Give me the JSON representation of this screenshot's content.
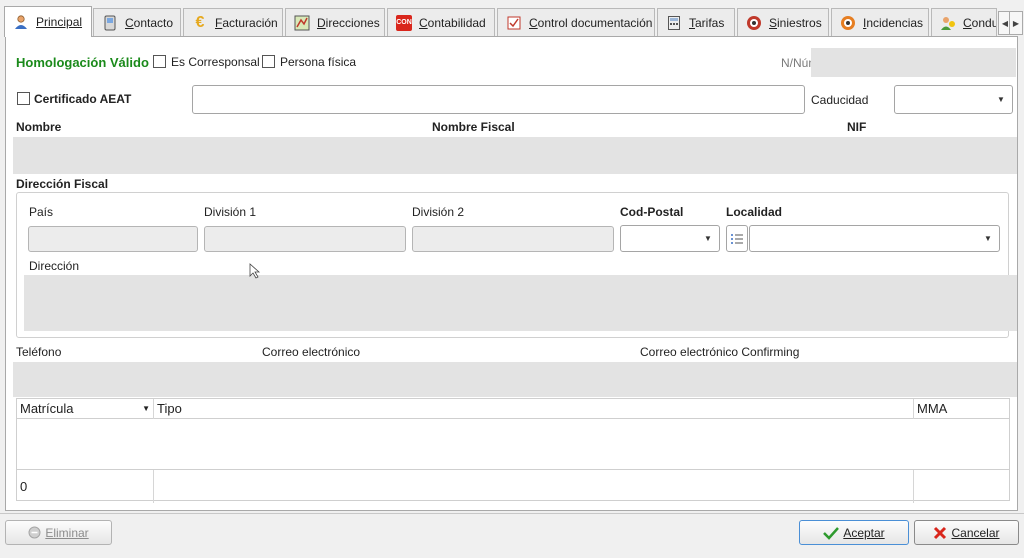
{
  "tabs": [
    {
      "label": "Principal",
      "icon": "person-icon",
      "active": true
    },
    {
      "label": "Contacto",
      "icon": "phone-icon"
    },
    {
      "label": "Facturación",
      "icon": "euro-icon"
    },
    {
      "label": "Direcciones",
      "icon": "map-icon"
    },
    {
      "label": "Contabilidad",
      "icon": "accounting-icon",
      "badge": "CON"
    },
    {
      "label": "Control documentación",
      "icon": "checklist-icon"
    },
    {
      "label": "Tarifas",
      "icon": "calculator-icon"
    },
    {
      "label": "Siniestros",
      "icon": "accident-icon"
    },
    {
      "label": "Incidencias",
      "icon": "incident-icon"
    },
    {
      "label": "Condu",
      "icon": "driver-icon"
    }
  ],
  "header": {
    "homologacion": "Homologación Válido",
    "es_corresponsal": "Es Corresponsal",
    "persona_fisica": "Persona física",
    "num_label": "N/Núm",
    "certificado": "Certificado AEAT",
    "caducidad": "Caducidad"
  },
  "identity": {
    "nombre": "Nombre",
    "nombre_fiscal": "Nombre Fiscal",
    "nif": "NIF"
  },
  "address": {
    "section": "Dirección Fiscal",
    "pais": "País",
    "division1": "División 1",
    "division2": "División 2",
    "cod_postal": "Cod-Postal",
    "localidad": "Localidad",
    "direccion": "Dirección"
  },
  "contact": {
    "telefono": "Teléfono",
    "correo": "Correo electrónico",
    "correo_confirming": "Correo electrónico Confirming"
  },
  "grid": {
    "columns": [
      "Matrícula",
      "Tipo",
      "MMA"
    ],
    "footer_count": "0"
  },
  "buttons": {
    "eliminar": "Eliminar",
    "aceptar": "Aceptar",
    "cancelar": "Cancelar"
  }
}
